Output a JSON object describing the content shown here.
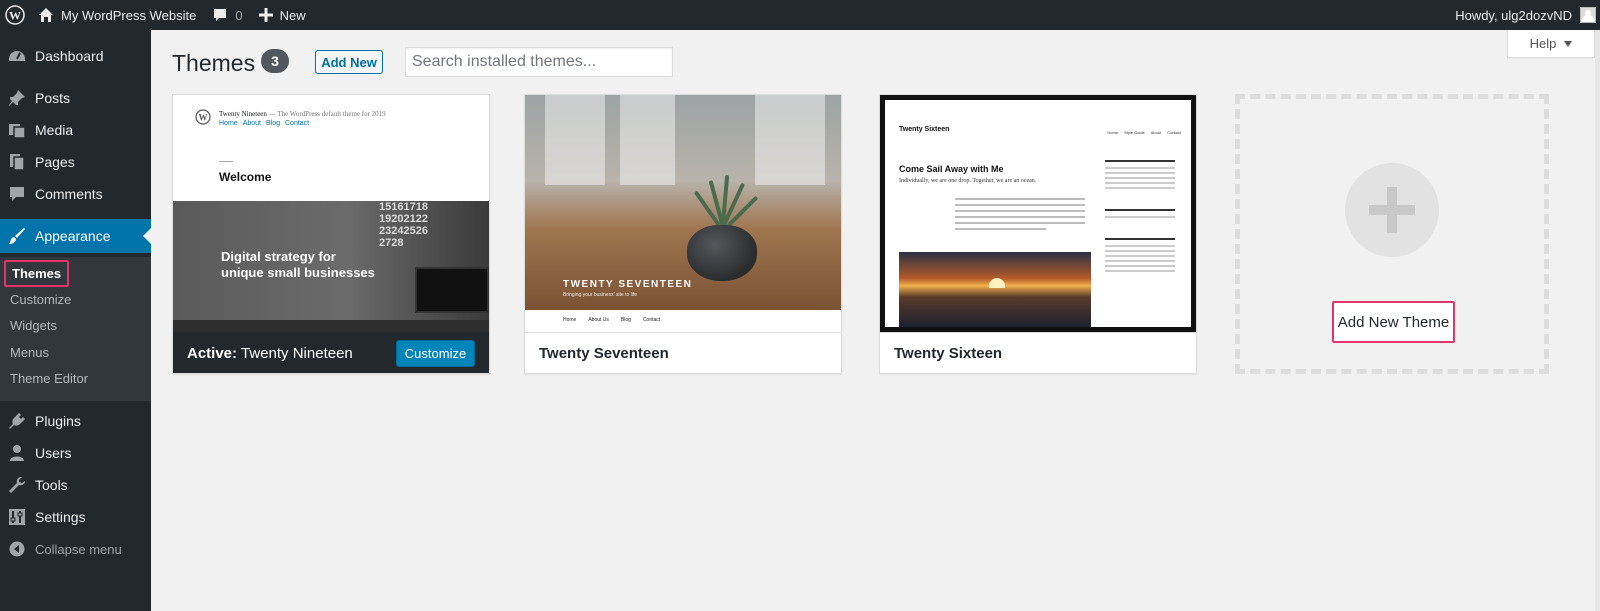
{
  "adminbar": {
    "site_name": "My WordPress Website",
    "comment_count": "0",
    "new_label": "New",
    "greeting": "Howdy, ulg2dozvND"
  },
  "sidebar": {
    "items": [
      {
        "label": "Dashboard",
        "icon": "dashboard-icon"
      },
      {
        "label": "Posts",
        "icon": "pin-icon"
      },
      {
        "label": "Media",
        "icon": "media-icon"
      },
      {
        "label": "Pages",
        "icon": "pages-icon"
      },
      {
        "label": "Comments",
        "icon": "comment-icon"
      },
      {
        "label": "Appearance",
        "icon": "paintbrush-icon"
      },
      {
        "label": "Plugins",
        "icon": "plugin-icon"
      },
      {
        "label": "Users",
        "icon": "user-icon"
      },
      {
        "label": "Tools",
        "icon": "wrench-icon"
      },
      {
        "label": "Settings",
        "icon": "settings-icon"
      }
    ],
    "submenu": [
      "Themes",
      "Customize",
      "Widgets",
      "Menus",
      "Theme Editor"
    ],
    "collapse_label": "Collapse menu"
  },
  "header": {
    "title": "Themes",
    "count": "3",
    "add_new_label": "Add New",
    "search_placeholder": "Search installed themes..."
  },
  "help_label": "Help",
  "themes": [
    {
      "name": "Twenty Nineteen",
      "active_prefix": "Active:",
      "customize_label": "Customize",
      "screenshot": {
        "site_title": "Twenty Nineteen",
        "tagline": "— The WordPress default theme for 2019",
        "nav": [
          "Home",
          "About",
          "Blog",
          "Contact"
        ],
        "welcome": "Welcome",
        "hero_text": "Digital strategy for unique small businesses",
        "calendar": [
          "15",
          "16",
          "17",
          "18",
          "19",
          "20",
          "21",
          "22",
          "23",
          "24",
          "25",
          "26",
          "27",
          "28"
        ]
      }
    },
    {
      "name": "Twenty Seventeen",
      "screenshot": {
        "title": "TWENTY SEVENTEEN",
        "tagline": "Bringing your business' site to life",
        "nav": [
          "Home",
          "About Us",
          "Blog",
          "Contact"
        ]
      }
    },
    {
      "name": "Twenty Sixteen",
      "screenshot": {
        "title": "Twenty Sixteen",
        "nav": [
          "Home",
          "Style Guide",
          "About",
          "Contact"
        ],
        "headline": "Come Sail Away with Me",
        "subhead": "Individually, we are one drop. Together, we are an ocean."
      }
    }
  ],
  "add_new_theme_label": "Add New Theme",
  "colors": {
    "adminbar_bg": "#23282d",
    "sidebar_bg": "#23282d",
    "accent_blue": "#0073aa",
    "highlight_pink": "#e5336b",
    "page_bg": "#f1f1f1"
  }
}
